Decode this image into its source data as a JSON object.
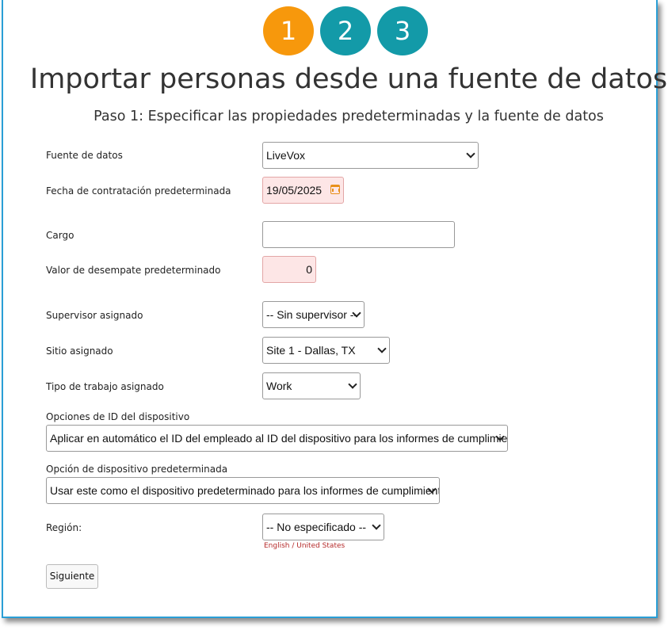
{
  "wizard": {
    "steps": [
      "1",
      "2",
      "3"
    ],
    "active_step": 1,
    "title": "Importar personas desde una fuente de datos",
    "subtitle": "Paso 1: Especificar las propiedades predeterminadas y la fuente de datos"
  },
  "form": {
    "data_source": {
      "label": "Fuente de datos",
      "value": "LiveVox"
    },
    "hire_date": {
      "label": "Fecha de contratación predeterminada",
      "value": "19/05/2025"
    },
    "position": {
      "label": "Cargo",
      "value": ""
    },
    "tiebreak": {
      "label": "Valor de desempate predeterminado",
      "value": "0"
    },
    "supervisor": {
      "label": "Supervisor asignado",
      "value": "-- Sin supervisor --"
    },
    "site": {
      "label": "Sitio asignado",
      "value": "Site 1 - Dallas, TX"
    },
    "work_type": {
      "label": "Tipo de trabajo asignado",
      "value": "Work"
    },
    "device_id_options": {
      "label": "Opciones de ID del dispositivo",
      "value": "Aplicar en automático el ID del empleado al ID del dispositivo para los informes de cumplimiento"
    },
    "default_device": {
      "label": "Opción de dispositivo predeterminada",
      "value": "Usar este como el dispositivo predeterminado para los informes de cumplimiento"
    },
    "region": {
      "label": "Región:",
      "value": "-- No especificado --",
      "locale_note": "English / United States"
    }
  },
  "buttons": {
    "next": "Siguiente"
  },
  "colors": {
    "active_step": "#f7980c",
    "inactive_step": "#139aa8",
    "frame_border": "#2a9fd6"
  },
  "icons": {
    "date_picker": "calendar-icon",
    "dropdown": "chevron-down-icon"
  }
}
